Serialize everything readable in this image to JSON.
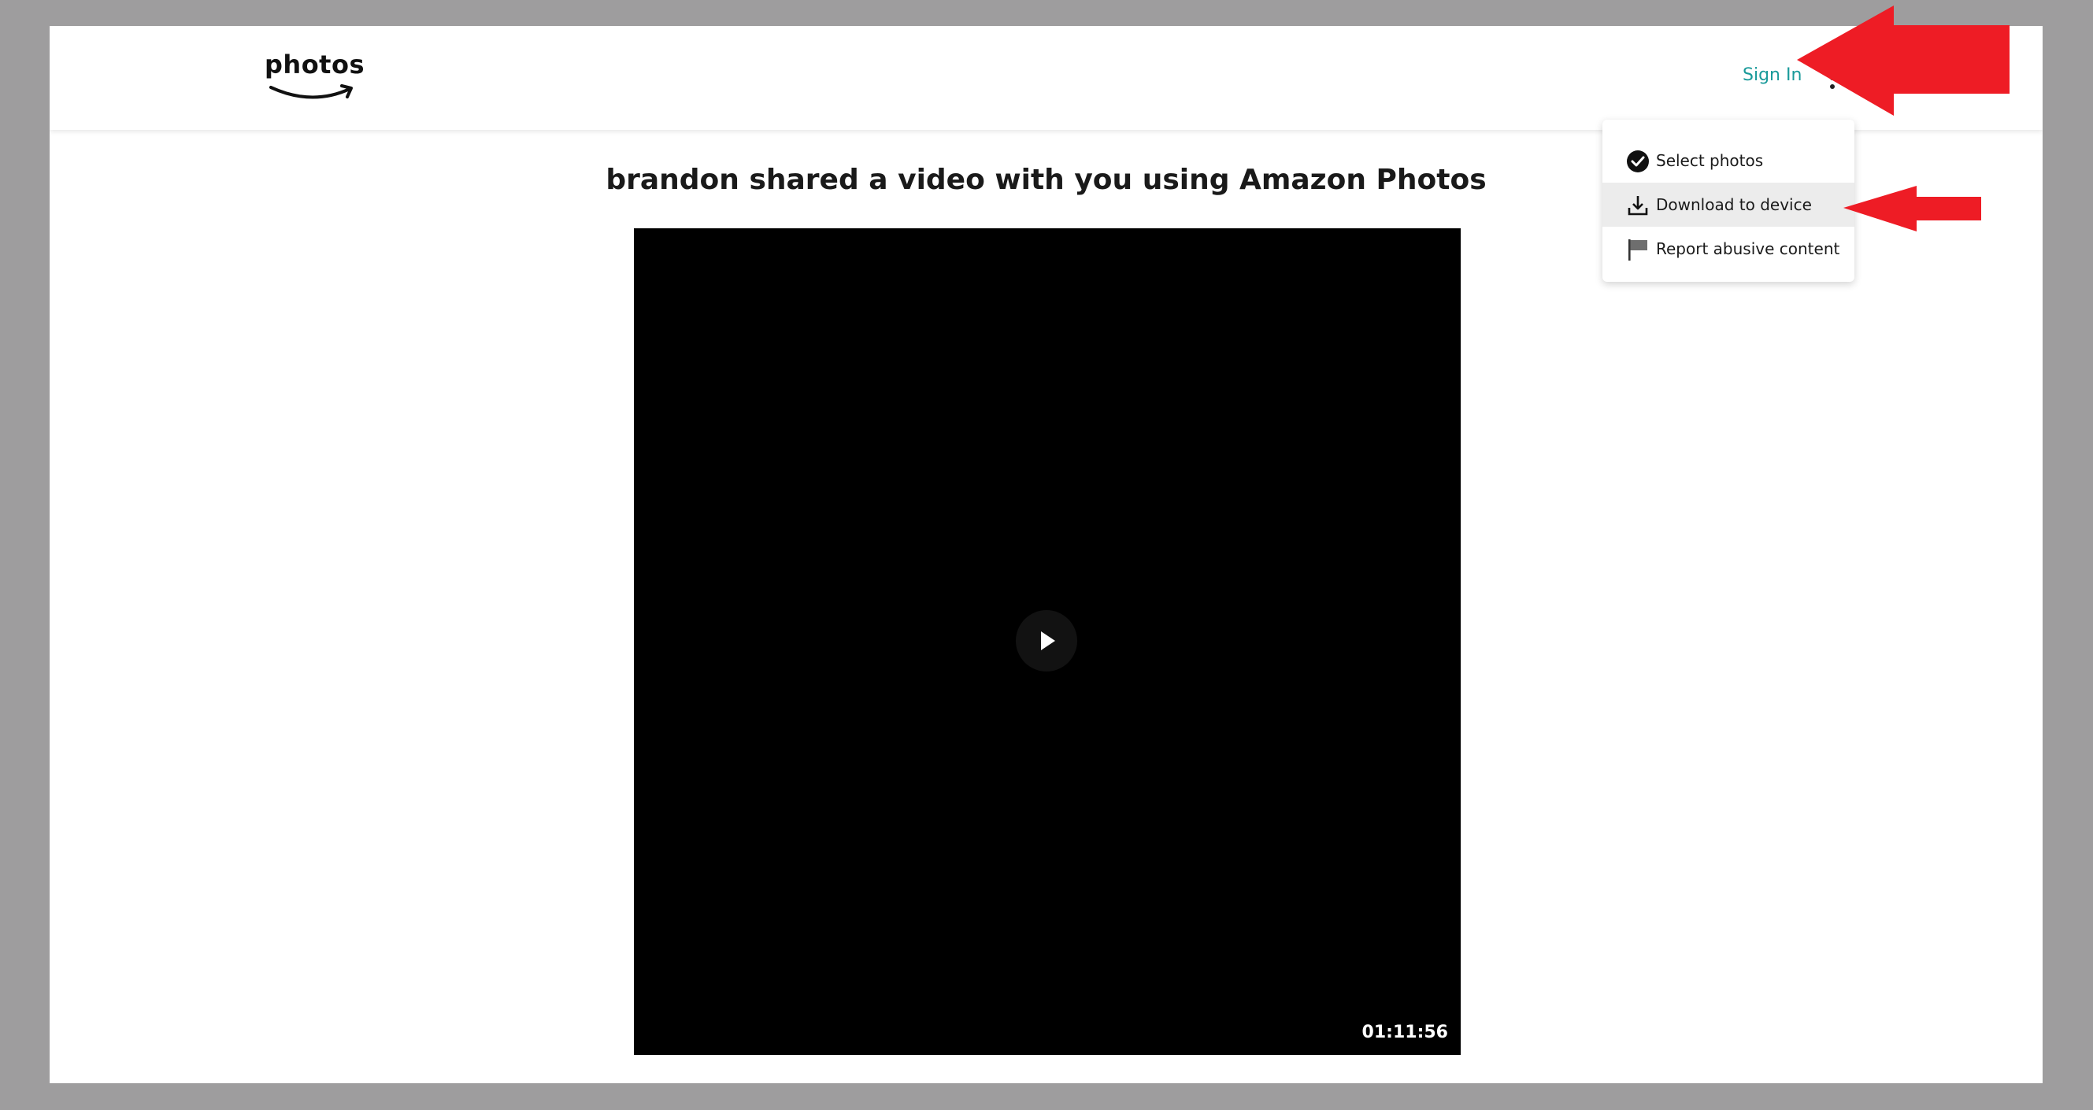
{
  "header": {
    "logo_text": "photos",
    "sign_in": "Sign In"
  },
  "main": {
    "title": "brandon shared a video with you using Amazon Photos",
    "video": {
      "duration": "01:11:56"
    }
  },
  "menu": {
    "items": [
      {
        "label": "Select photos",
        "icon": "check-circle-icon"
      },
      {
        "label": "Download to device",
        "icon": "download-icon",
        "highlighted": true
      },
      {
        "label": "Report abusive content",
        "icon": "flag-icon"
      }
    ]
  },
  "annotations": {
    "arrow_color": "#ee1c25"
  },
  "colors": {
    "accent": "#1a9a9a",
    "backdrop": "#9e9d9e"
  }
}
